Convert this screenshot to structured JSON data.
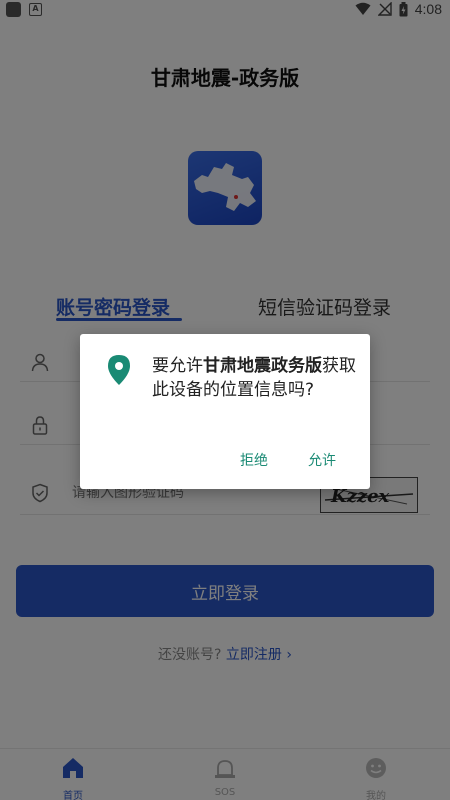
{
  "status_bar": {
    "time": "4:08"
  },
  "app": {
    "title": "甘肃地震-政务版"
  },
  "tabs": [
    {
      "label": "账号密码登录"
    },
    {
      "label": "短信验证码登录"
    }
  ],
  "form": {
    "captcha_placeholder": "请输入图形验证码",
    "captcha_text": "Kzzex"
  },
  "login_button": "立即登录",
  "register": {
    "prompt": "还没账号?",
    "link": "立即注册",
    "chevron": "›"
  },
  "bottom_nav": [
    {
      "label": "首页",
      "icon": "home-icon"
    },
    {
      "label": "SOS",
      "icon": "sos-icon"
    },
    {
      "label": "我的",
      "icon": "profile-icon"
    }
  ],
  "dialog": {
    "text_before": "要允许",
    "app_name": "甘肃地震政务版",
    "text_after": "获取此设备的位置信息吗?",
    "deny_label": "拒绝",
    "allow_label": "允许",
    "accent_color": "#1a8a74"
  },
  "colors": {
    "primary": "#2a56c8"
  }
}
